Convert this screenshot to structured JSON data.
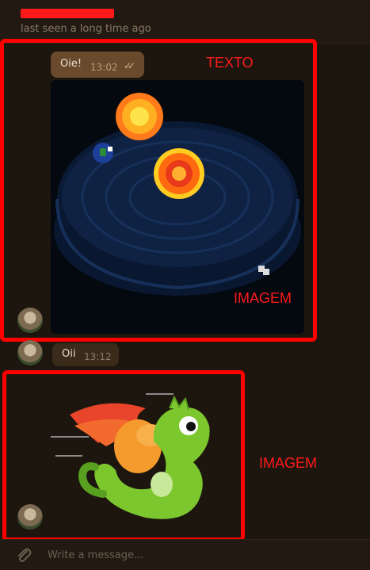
{
  "header": {
    "contact_name": "",
    "status": "last seen a long time ago"
  },
  "messages": {
    "outgoing_1": {
      "text": "Oie!",
      "time": "13:02",
      "read_icon": "double-check-icon"
    },
    "incoming_1": {
      "text": "Oii",
      "time": "13:12"
    }
  },
  "annotations": {
    "texto": "TEXTO",
    "imagem_1": "IMAGEM",
    "imagem_2": "IMAGEM"
  },
  "composer": {
    "placeholder": "Write a message...",
    "attach_icon": "paperclip-icon"
  },
  "colors": {
    "annotation_red": "#ff0000",
    "background": "#1d160f",
    "outgoing_bubble": "#6a4a2c",
    "incoming_bubble": "#3a2a1a"
  }
}
